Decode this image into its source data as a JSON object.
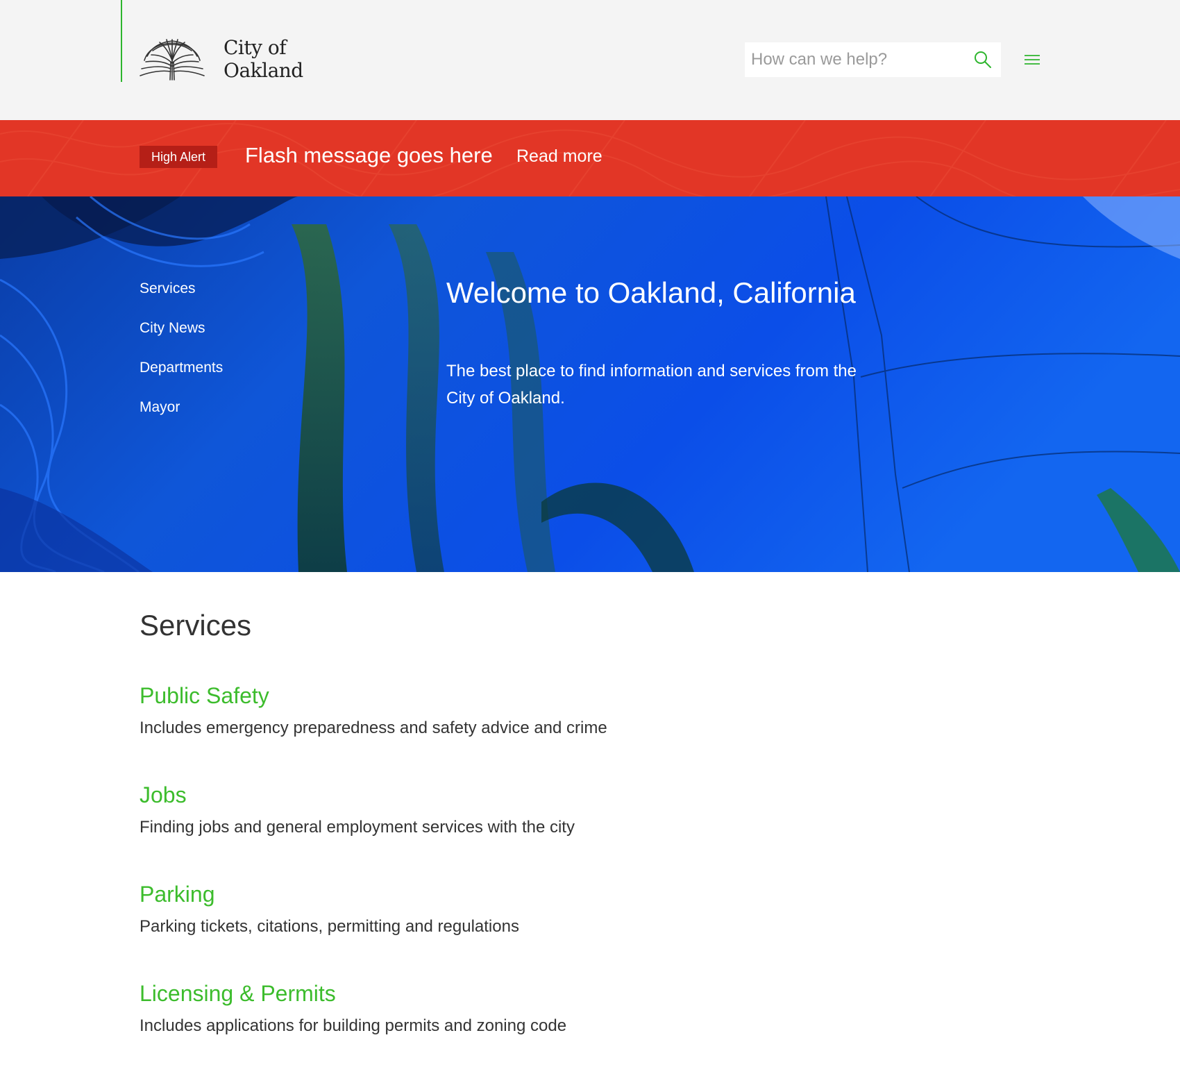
{
  "header": {
    "logo_line1": "City of",
    "logo_line2": "Oakland",
    "search_placeholder": "How can we help?",
    "accent_color": "#2db52d",
    "icons": [
      "oak-tree-logo-icon",
      "search-icon",
      "hamburger-menu-icon"
    ]
  },
  "alert": {
    "badge": "High Alert",
    "message": "Flash message goes here",
    "link_label": "Read more",
    "background_color": "#e23626",
    "badge_color": "#b51f17"
  },
  "hero": {
    "nav": [
      "Services",
      "City News",
      "Departments",
      "Mayor"
    ],
    "title": "Welcome to Oakland, California",
    "intro": "The best place to find information and services from the City of Oakland."
  },
  "services": {
    "heading": "Services",
    "link_color": "#3cbc2c",
    "items": [
      {
        "title": "Public Safety",
        "description": "Includes emergency preparedness and safety advice and crime"
      },
      {
        "title": "Jobs",
        "description": "Finding jobs and general employment services with the city"
      },
      {
        "title": "Parking",
        "description": "Parking tickets, citations, permitting and regulations"
      },
      {
        "title": "Licensing & Permits",
        "description": "Includes applications for building permits and zoning code"
      }
    ]
  }
}
